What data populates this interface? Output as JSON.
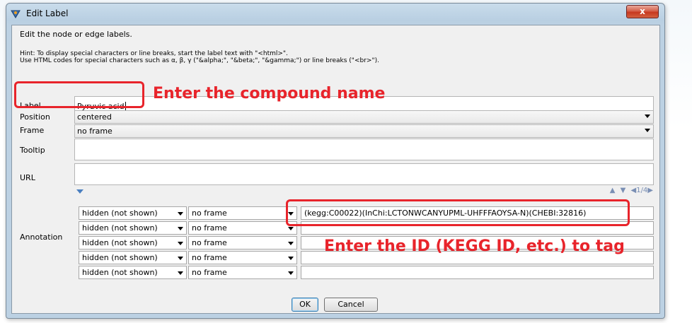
{
  "window": {
    "title": "Edit Label",
    "close_label": "x"
  },
  "description": "Edit the node or edge labels.",
  "hint": {
    "line1": "Hint: To display special characters or line breaks, start the label text with \"<html>\".",
    "line2": "Use HTML codes for special characters such as α, β, γ (\"&alpha;\", \"&beta;\", \"&gamma;\") or line breaks (\"<br>\")."
  },
  "fields": {
    "label": {
      "caption": "Label",
      "value": "Pyruvic acid"
    },
    "position": {
      "caption": "Position",
      "value": "centered"
    },
    "frame": {
      "caption": "Frame",
      "value": "no frame"
    },
    "tooltip": {
      "caption": "Tooltip",
      "value": ""
    },
    "url": {
      "caption": "URL",
      "value": ""
    },
    "annotation": {
      "caption": "Annotation"
    }
  },
  "annotation_nav": {
    "page": "1/4"
  },
  "annotations": [
    {
      "visibility": "hidden (not shown)",
      "frame": "no frame",
      "value": "(kegg:C00022)(InChi:LCTONWCANYUPML-UHFFFAOYSA-N)(CHEBI:32816)"
    },
    {
      "visibility": "hidden (not shown)",
      "frame": "no frame",
      "value": ""
    },
    {
      "visibility": "hidden (not shown)",
      "frame": "no frame",
      "value": ""
    },
    {
      "visibility": "hidden (not shown)",
      "frame": "no frame",
      "value": ""
    },
    {
      "visibility": "hidden (not shown)",
      "frame": "no frame",
      "value": ""
    }
  ],
  "buttons": {
    "ok": "OK",
    "cancel": "Cancel"
  },
  "callouts": {
    "label_note": "Enter the compound name",
    "annotation_note": "Enter the ID (KEGG ID, etc.) to tag"
  },
  "colors": {
    "callout": "#e8242b",
    "accent": "#4a7fc0"
  }
}
